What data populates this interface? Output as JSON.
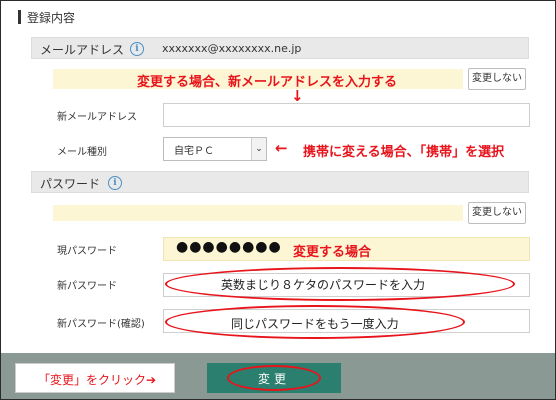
{
  "section_title": "登録内容",
  "email": {
    "label": "メールアドレス",
    "info_icon_char": "i",
    "current_value": "xxxxxxx@xxxxxxxx.ne.jp",
    "no_change_button": "変更しない",
    "annotation": "変更する場合、新メールアドレスを入力する",
    "annotation_arrow": "↓",
    "new_email_label": "新メールアドレス",
    "new_email_value": "",
    "type_label": "メール種別",
    "type_selected": "自宅ＰＣ",
    "type_annotation": "携帯に変える場合、「携帯」を選択",
    "type_annotation_arrow": "←"
  },
  "password": {
    "label": "パスワード",
    "info_icon_char": "i",
    "no_change_button": "変更しない",
    "current_label": "現パスワード",
    "current_masked": "●●●●●●●●",
    "current_annotation": "変更する場合",
    "new_label": "新パスワード",
    "new_annotation": "英数まじり８ケタのパスワードを入力",
    "confirm_label": "新パスワード(確認)",
    "confirm_annotation": "同じパスワードをもう一度入力"
  },
  "footer": {
    "click_hint": "「変更」をクリック➔",
    "submit_label": "変更"
  },
  "colors": {
    "annotation_red": "#e8141b",
    "highlight_yellow": "#fcf6d5",
    "submit_green": "#2a7f6f",
    "footer_gray": "#8a9993"
  }
}
